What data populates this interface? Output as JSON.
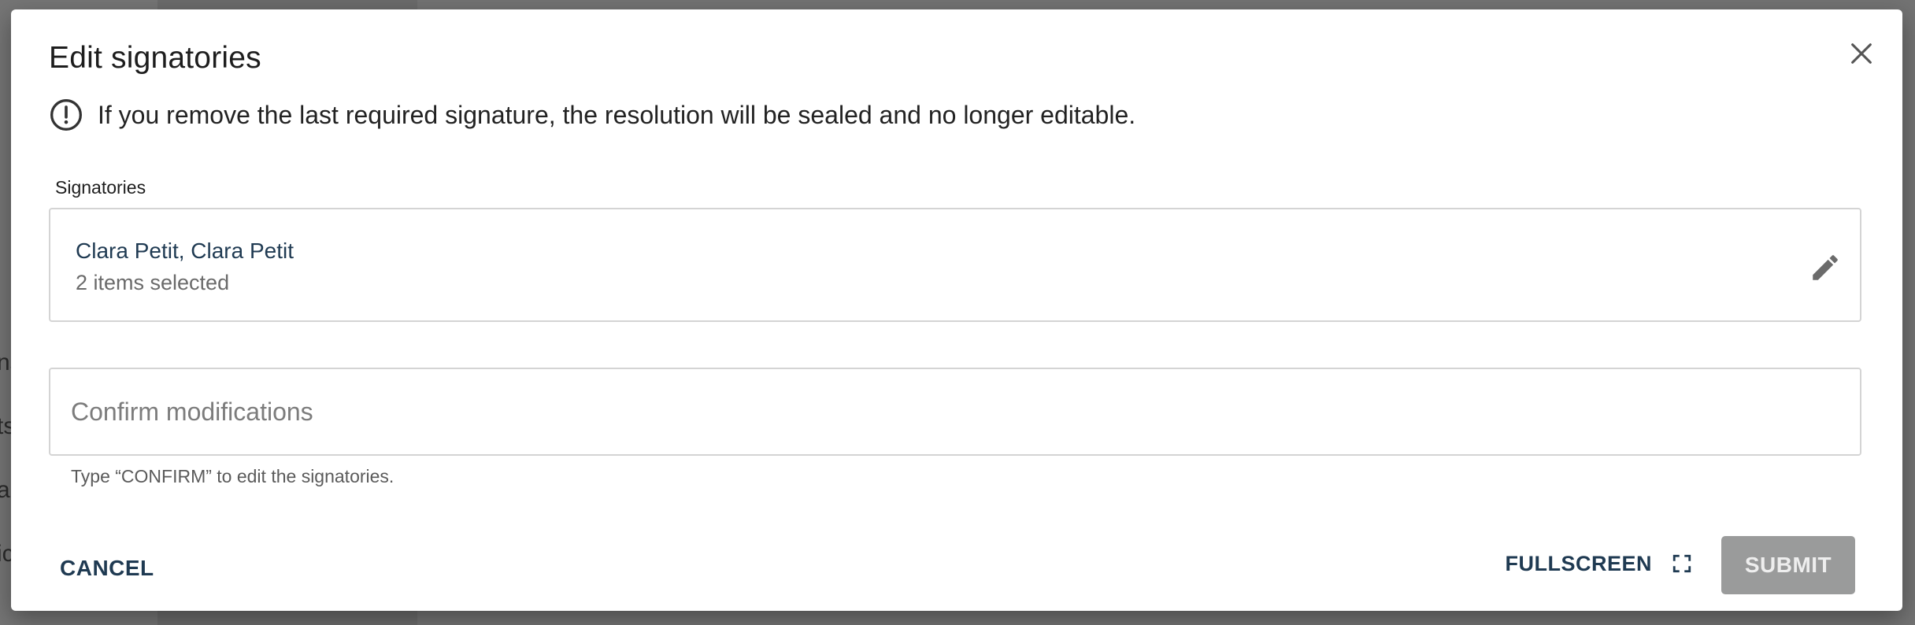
{
  "background": {
    "fragments": [
      "ns",
      "ts",
      "a",
      "ic"
    ]
  },
  "dialog": {
    "title": "Edit signatories",
    "close_icon": "close-icon",
    "warning": {
      "icon": "exclamation-circle-icon",
      "text": "If you remove the last required signature, the resolution will be sealed and no longer editable."
    },
    "signatories": {
      "label": "Signatories",
      "selected_names": "Clara Petit, Clara Petit",
      "selected_count": "2 items selected",
      "edit_icon": "pencil-icon"
    },
    "confirm": {
      "value": "",
      "placeholder": "Confirm modifications",
      "helper": "Type “CONFIRM” to edit the signatories."
    },
    "footer": {
      "cancel_label": "CANCEL",
      "fullscreen_label": "FULLSCREEN",
      "fullscreen_icon": "fullscreen-icon",
      "submit_label": "SUBMIT",
      "submit_disabled": true
    }
  },
  "colors": {
    "accent_text": "#1f3a52",
    "disabled_button": "#9a9b9b",
    "overlay": "#737373"
  }
}
